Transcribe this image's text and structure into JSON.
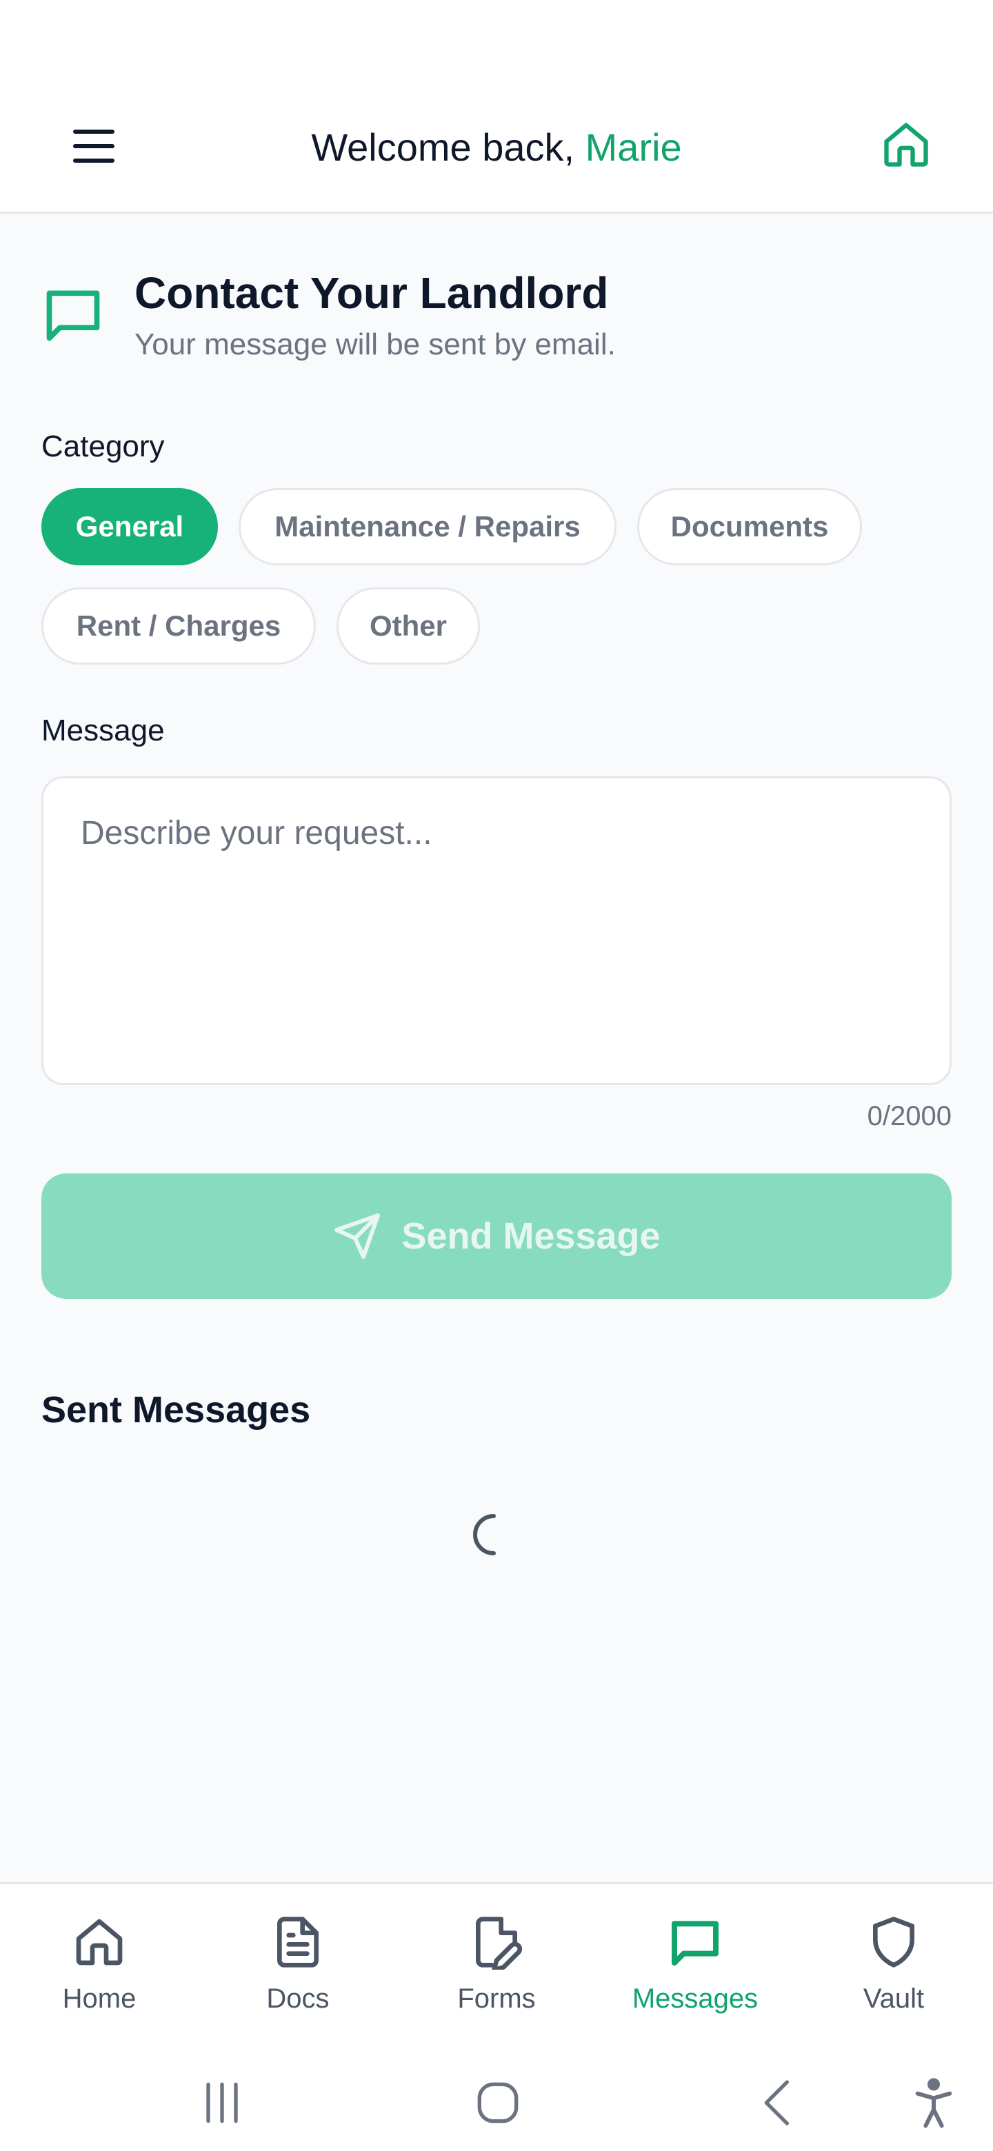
{
  "header": {
    "greeting": "Welcome back, ",
    "user_name": "Marie"
  },
  "contact": {
    "title": "Contact Your Landlord",
    "subtitle": "Your message will be sent by email."
  },
  "category": {
    "label": "Category",
    "selected": "General",
    "options": [
      "General",
      "Maintenance / Repairs",
      "Documents",
      "Rent / Charges",
      "Other"
    ]
  },
  "message": {
    "label": "Message",
    "placeholder": "Describe your request...",
    "value": "",
    "counter": "0/2000"
  },
  "send_button": {
    "label": "Send Message"
  },
  "sent_messages": {
    "title": "Sent Messages"
  },
  "bottom_nav": {
    "items": [
      {
        "label": "Home",
        "icon": "home-icon"
      },
      {
        "label": "Docs",
        "icon": "document-icon"
      },
      {
        "label": "Forms",
        "icon": "file-edit-icon"
      },
      {
        "label": "Messages",
        "icon": "message-square-icon"
      },
      {
        "label": "Vault",
        "icon": "shield-icon"
      }
    ],
    "active": "Messages"
  },
  "colors": {
    "accent": "#16b27a",
    "accent_text": "#10a36b",
    "button_disabled": "#87dbbe",
    "text_primary": "#0f172a",
    "text_muted": "#6b7280",
    "border": "#e5e7eb"
  }
}
